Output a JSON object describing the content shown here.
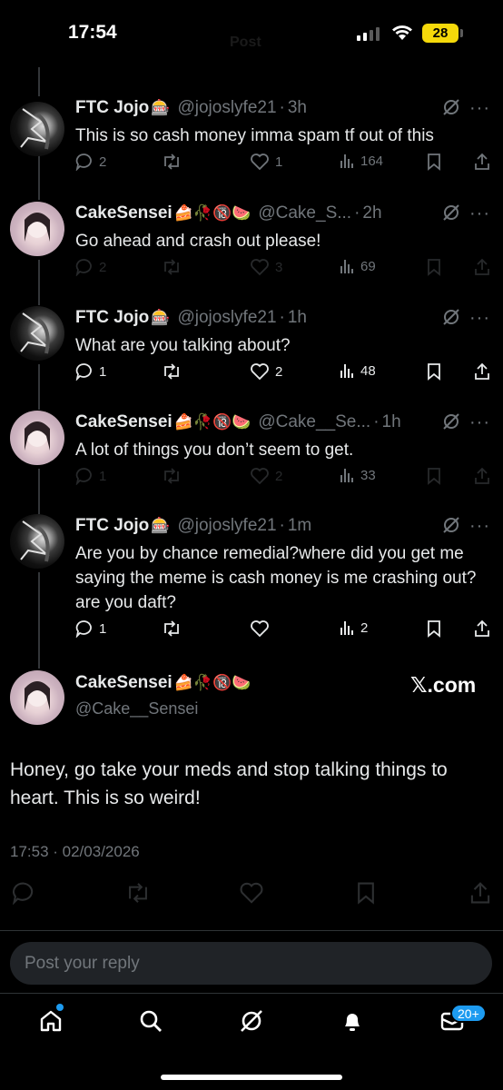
{
  "status_bar": {
    "time": "17:54",
    "battery": "28"
  },
  "header": {
    "title": "Post"
  },
  "posts": [
    {
      "name": "FTC Jojo",
      "emojis": "🎰",
      "handle": "@jojoslyfe21",
      "time": "3h",
      "text": "This is so cash money imma spam tf out of this",
      "replies": "2",
      "reposts": "",
      "likes": "1",
      "views": "164"
    },
    {
      "name": "CakeSensei",
      "emojis": "🍰🥀🔞🍉",
      "handle": "@Cake_S...",
      "time": "2h",
      "text": "Go ahead and crash out please!",
      "replies": "2",
      "reposts": "",
      "likes": "3",
      "views": "69"
    },
    {
      "name": "FTC Jojo",
      "emojis": "🎰",
      "handle": "@jojoslyfe21",
      "time": "1h",
      "text": "What are you talking about?",
      "replies": "1",
      "reposts": "",
      "likes": "2",
      "views": "48"
    },
    {
      "name": "CakeSensei",
      "emojis": "🍰🥀🔞🍉",
      "handle": "@Cake__Se...",
      "time": "1h",
      "text": "A lot of things you don’t seem to get.",
      "replies": "1",
      "reposts": "",
      "likes": "2",
      "views": "33"
    },
    {
      "name": "FTC Jojo",
      "emojis": "🎰",
      "handle": "@jojoslyfe21",
      "time": "1m",
      "text": "Are you by chance remedial?where did you get me saying the meme is cash money is me crashing out?are you daft?",
      "replies": "1",
      "reposts": "",
      "likes": "",
      "views": "2"
    }
  ],
  "focused": {
    "name": "CakeSensei",
    "emojis": "🍰🥀🔞🍉",
    "handle": "@Cake__Sensei",
    "watermark": "𝕏.com",
    "text": "Honey, go take your meds and stop talking things to heart. This is so weird!",
    "timestamp": "17:53 · 02/03/2026"
  },
  "reply": {
    "placeholder": "Post your reply"
  },
  "nav": {
    "badge": "20+"
  },
  "colors": {
    "accent": "#1d9bf0",
    "muted": "#71767b",
    "battery": "#f5d90a"
  }
}
